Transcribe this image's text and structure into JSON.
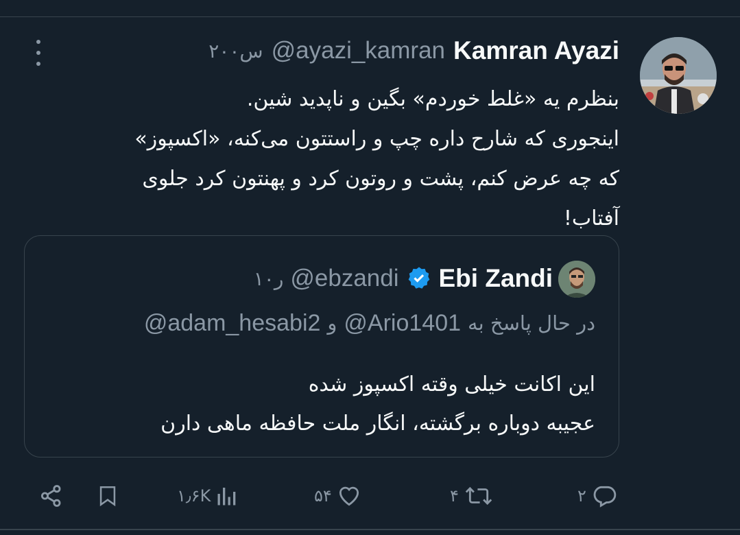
{
  "tweet": {
    "author_name": "Kamran Ayazi",
    "handle": "@ayazi_kamran",
    "time": "۲۰۰س",
    "lines": [
      "بنظرم یه «غلط خوردم» بگین و ناپدید شین.",
      "اینجوری که شارح داره چپ و راستتون می‌کنه، «اکسپوز»",
      "که چه عرض کنم، پشت و روتون کرد و پهنتون کرد جلوی",
      "آفتاب!"
    ]
  },
  "quote": {
    "author_name": "Ebi Zandi",
    "handle": "@ebzandi",
    "time": "۱۰ر",
    "reply_prefix": "در حال پاسخ به",
    "reply_to_1": "@Ario1401",
    "reply_joiner": "و",
    "reply_to_2": "@adam_hesabi2",
    "lines": [
      "این اکانت خیلی وقته اکسپوز شده",
      "عجیبه دوباره برگشته، انگار ملت حافظه ماهی دارن"
    ]
  },
  "actions": {
    "replies": "۲",
    "retweets": "۴",
    "likes": "۵۴",
    "views": "۱٫۶K"
  },
  "icons": {
    "more": "more-vertical-icon",
    "verified": "verified-badge-icon",
    "reply": "reply-icon",
    "retweet": "retweet-icon",
    "like": "heart-icon",
    "views": "views-chart-icon",
    "bookmark": "bookmark-icon",
    "share": "share-icon"
  },
  "colors": {
    "background": "#15202b",
    "text": "#f7f9f9",
    "muted": "#8b98a5",
    "border": "#38444d",
    "verified": "#1d9bf0"
  }
}
